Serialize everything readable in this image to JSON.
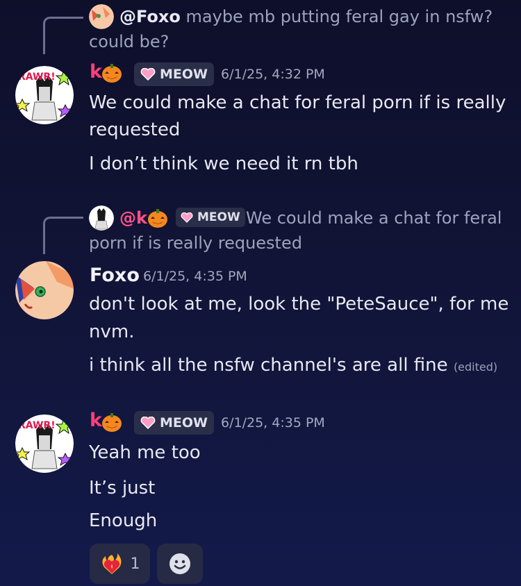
{
  "messages": [
    {
      "reply": {
        "mention": "@Foxo",
        "text_line1": "maybe mb putting feral gay in nsfw?",
        "text_line2": "could be?"
      },
      "author": "k",
      "tag": "MEOW",
      "timestamp": "6/1/25, 4:32 PM",
      "lines": [
        "We could make a chat for feral porn if is really",
        "requested",
        "I don’t think we need it rn tbh"
      ]
    },
    {
      "reply": {
        "mention": "@k",
        "tag": "MEOW",
        "text_line1": "We could make a chat for feral",
        "text_line2": "porn if is really requested"
      },
      "author": "Foxo",
      "timestamp": "6/1/25, 4:35 PM",
      "lines": [
        "don't look at me, look the \"PeteSauce\", for me",
        "nvm.",
        "i think all the nsfw channel's are all fine"
      ],
      "edited": "(edited)"
    },
    {
      "author": "k",
      "tag": "MEOW",
      "timestamp": "6/1/25, 4:35 PM",
      "lines": [
        "Yeah me too",
        "It’s just",
        "Enough"
      ],
      "reactions": [
        {
          "emoji": "heart-on-fire-icon",
          "count": "1"
        },
        {
          "emoji": "add-reaction-icon"
        }
      ]
    }
  ],
  "colors": {
    "background_top": "#0e0f2b",
    "background_bottom": "#131a4a",
    "username_pink": "#ff3f7a",
    "mention_pink": "#ff4f86",
    "tag_bg": "#2b2e49"
  }
}
